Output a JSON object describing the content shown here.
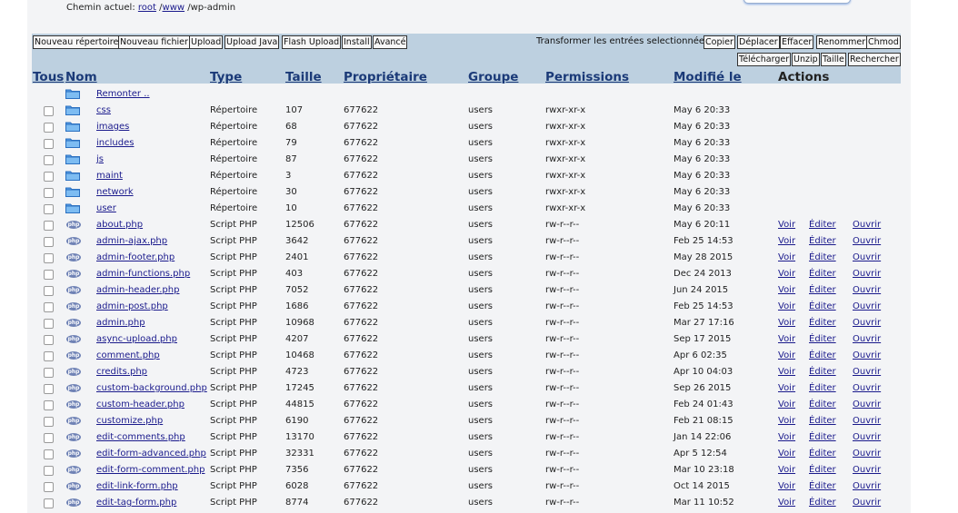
{
  "path": {
    "label": "Chemin actuel:",
    "root": "root",
    "sep1": "/",
    "www": "www",
    "rest": "/wp-admin"
  },
  "toolbar": {
    "left_buttons": [
      "Nouveau répertoire",
      "Nouveau fichier",
      "Upload",
      "Upload Java",
      "Flash Upload",
      "Install",
      "Avancé"
    ],
    "transform_label": "Transformer les entrées selectionnées:",
    "right_buttons_row1": [
      "Copier",
      "Déplacer",
      "Effacer",
      "Renommer",
      "Chmod"
    ],
    "right_buttons_row2": [
      "Télécharger",
      "Unzip",
      "Taille",
      "Rechercher"
    ]
  },
  "columns": {
    "tous": "Tous",
    "nom": "Nom",
    "type": "Type",
    "taille": "Taille",
    "proprietaire": "Propriétaire",
    "groupe": "Groupe",
    "permissions": "Permissions",
    "modifie": "Modifié le",
    "actions": "Actions"
  },
  "parent_link": "Remonter ..",
  "action_labels": {
    "voir": "Voir",
    "editer": "Éditer",
    "ouvrir": "Ouvrir"
  },
  "icons": {
    "folder": "folder-icon",
    "php": "php-file-icon",
    "php_text": "php"
  },
  "colors": {
    "toolbar_bg": "#bdd0e0",
    "link": "#1a1a8c",
    "header_text": "#1b3a78"
  },
  "files": [
    {
      "name": "css",
      "type": "Répertoire",
      "size": "107",
      "owner": "677622",
      "group": "users",
      "perm": "rwxr-xr-x",
      "date": "May 6 20:33",
      "kind": "dir"
    },
    {
      "name": "images",
      "type": "Répertoire",
      "size": "68",
      "owner": "677622",
      "group": "users",
      "perm": "rwxr-xr-x",
      "date": "May 6 20:33",
      "kind": "dir"
    },
    {
      "name": "includes",
      "type": "Répertoire",
      "size": "79",
      "owner": "677622",
      "group": "users",
      "perm": "rwxr-xr-x",
      "date": "May 6 20:33",
      "kind": "dir"
    },
    {
      "name": "js",
      "type": "Répertoire",
      "size": "87",
      "owner": "677622",
      "group": "users",
      "perm": "rwxr-xr-x",
      "date": "May 6 20:33",
      "kind": "dir"
    },
    {
      "name": "maint",
      "type": "Répertoire",
      "size": "3",
      "owner": "677622",
      "group": "users",
      "perm": "rwxr-xr-x",
      "date": "May 6 20:33",
      "kind": "dir"
    },
    {
      "name": "network",
      "type": "Répertoire",
      "size": "30",
      "owner": "677622",
      "group": "users",
      "perm": "rwxr-xr-x",
      "date": "May 6 20:33",
      "kind": "dir"
    },
    {
      "name": "user",
      "type": "Répertoire",
      "size": "10",
      "owner": "677622",
      "group": "users",
      "perm": "rwxr-xr-x",
      "date": "May 6 20:33",
      "kind": "dir"
    },
    {
      "name": "about.php",
      "type": "Script PHP",
      "size": "12506",
      "owner": "677622",
      "group": "users",
      "perm": "rw-r--r--",
      "date": "May 6 20:11",
      "kind": "php"
    },
    {
      "name": "admin-ajax.php",
      "type": "Script PHP",
      "size": "3642",
      "owner": "677622",
      "group": "users",
      "perm": "rw-r--r--",
      "date": "Feb 25 14:53",
      "kind": "php"
    },
    {
      "name": "admin-footer.php",
      "type": "Script PHP",
      "size": "2401",
      "owner": "677622",
      "group": "users",
      "perm": "rw-r--r--",
      "date": "May 28 2015",
      "kind": "php"
    },
    {
      "name": "admin-functions.php",
      "type": "Script PHP",
      "size": "403",
      "owner": "677622",
      "group": "users",
      "perm": "rw-r--r--",
      "date": "Dec 24 2013",
      "kind": "php"
    },
    {
      "name": "admin-header.php",
      "type": "Script PHP",
      "size": "7052",
      "owner": "677622",
      "group": "users",
      "perm": "rw-r--r--",
      "date": "Jun 24 2015",
      "kind": "php"
    },
    {
      "name": "admin-post.php",
      "type": "Script PHP",
      "size": "1686",
      "owner": "677622",
      "group": "users",
      "perm": "rw-r--r--",
      "date": "Feb 25 14:53",
      "kind": "php"
    },
    {
      "name": "admin.php",
      "type": "Script PHP",
      "size": "10968",
      "owner": "677622",
      "group": "users",
      "perm": "rw-r--r--",
      "date": "Mar 27 17:16",
      "kind": "php"
    },
    {
      "name": "async-upload.php",
      "type": "Script PHP",
      "size": "4207",
      "owner": "677622",
      "group": "users",
      "perm": "rw-r--r--",
      "date": "Sep 17 2015",
      "kind": "php"
    },
    {
      "name": "comment.php",
      "type": "Script PHP",
      "size": "10468",
      "owner": "677622",
      "group": "users",
      "perm": "rw-r--r--",
      "date": "Apr 6 02:35",
      "kind": "php"
    },
    {
      "name": "credits.php",
      "type": "Script PHP",
      "size": "4723",
      "owner": "677622",
      "group": "users",
      "perm": "rw-r--r--",
      "date": "Apr 10 04:03",
      "kind": "php"
    },
    {
      "name": "custom-background.php",
      "type": "Script PHP",
      "size": "17245",
      "owner": "677622",
      "group": "users",
      "perm": "rw-r--r--",
      "date": "Sep 26 2015",
      "kind": "php"
    },
    {
      "name": "custom-header.php",
      "type": "Script PHP",
      "size": "44815",
      "owner": "677622",
      "group": "users",
      "perm": "rw-r--r--",
      "date": "Feb 24 01:43",
      "kind": "php"
    },
    {
      "name": "customize.php",
      "type": "Script PHP",
      "size": "6190",
      "owner": "677622",
      "group": "users",
      "perm": "rw-r--r--",
      "date": "Feb 21 08:15",
      "kind": "php"
    },
    {
      "name": "edit-comments.php",
      "type": "Script PHP",
      "size": "13170",
      "owner": "677622",
      "group": "users",
      "perm": "rw-r--r--",
      "date": "Jan 14 22:06",
      "kind": "php"
    },
    {
      "name": "edit-form-advanced.php",
      "type": "Script PHP",
      "size": "32331",
      "owner": "677622",
      "group": "users",
      "perm": "rw-r--r--",
      "date": "Apr 5 12:54",
      "kind": "php"
    },
    {
      "name": "edit-form-comment.php",
      "type": "Script PHP",
      "size": "7356",
      "owner": "677622",
      "group": "users",
      "perm": "rw-r--r--",
      "date": "Mar 10 23:18",
      "kind": "php"
    },
    {
      "name": "edit-link-form.php",
      "type": "Script PHP",
      "size": "6028",
      "owner": "677622",
      "group": "users",
      "perm": "rw-r--r--",
      "date": "Oct 14 2015",
      "kind": "php"
    },
    {
      "name": "edit-tag-form.php",
      "type": "Script PHP",
      "size": "8774",
      "owner": "677622",
      "group": "users",
      "perm": "rw-r--r--",
      "date": "Mar 11 10:52",
      "kind": "php"
    }
  ]
}
